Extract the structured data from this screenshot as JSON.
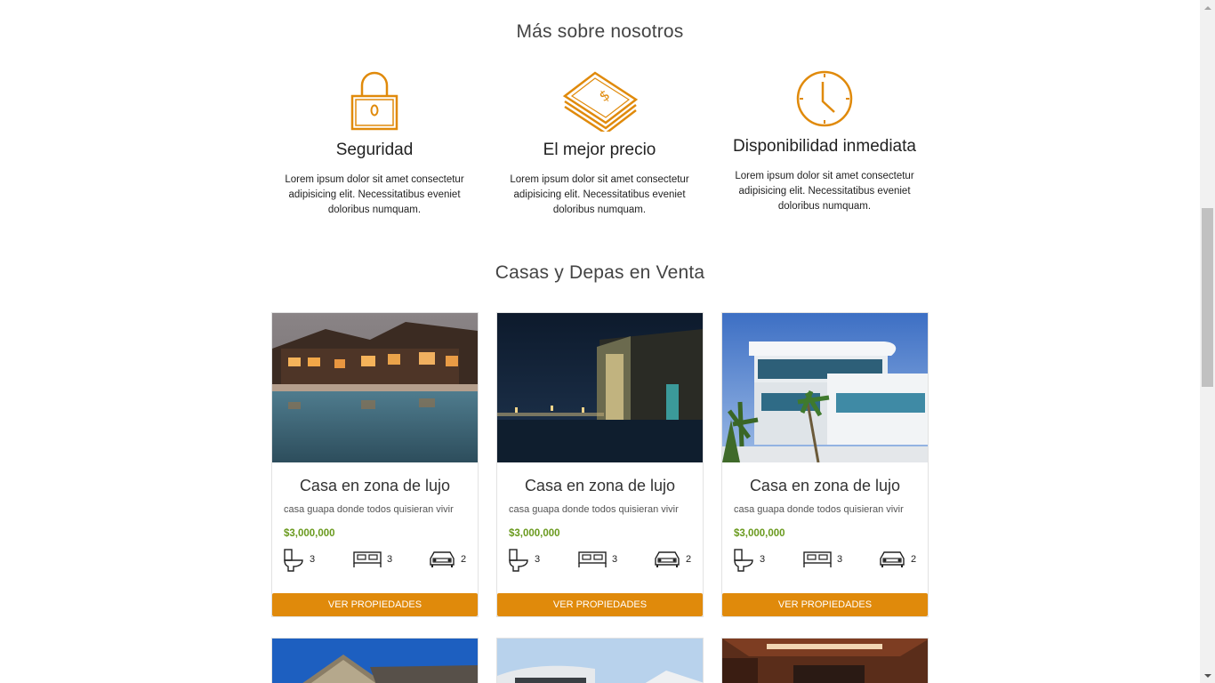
{
  "about": {
    "title": "Más sobre nosotros",
    "items": [
      {
        "icon": "lock-icon",
        "title": "Seguridad",
        "text": "Lorem ipsum dolor sit amet consectetur adipisicing elit. Necessitatibus eveniet doloribus numquam."
      },
      {
        "icon": "money-icon",
        "title": "El mejor precio",
        "text": "Lorem ipsum dolor sit amet consectetur adipisicing elit. Necessitatibus eveniet doloribus numquam."
      },
      {
        "icon": "clock-icon",
        "title": "Disponibilidad inmediata",
        "text": "Lorem ipsum dolor sit amet consectetur adipisicing elit. Necessitatibus eveniet doloribus numquam."
      }
    ]
  },
  "listings": {
    "title": "Casas y Depas en Venta",
    "cards": [
      {
        "title": "Casa en zona de lujo",
        "desc": "casa guapa donde todos quisieran vivir",
        "price": "$3,000,000",
        "baths": "3",
        "beds": "3",
        "parking": "2",
        "button": "VER PROPIEDADES"
      },
      {
        "title": "Casa en zona de lujo",
        "desc": "casa guapa donde todos quisieran vivir",
        "price": "$3,000,000",
        "baths": "3",
        "beds": "3",
        "parking": "2",
        "button": "VER PROPIEDADES"
      },
      {
        "title": "Casa en zona de lujo",
        "desc": "casa guapa donde todos quisieran vivir",
        "price": "$3,000,000",
        "baths": "3",
        "beds": "3",
        "parking": "2",
        "button": "VER PROPIEDADES"
      }
    ]
  },
  "colors": {
    "accent": "#e08a0b",
    "price": "#6a9a1e"
  }
}
